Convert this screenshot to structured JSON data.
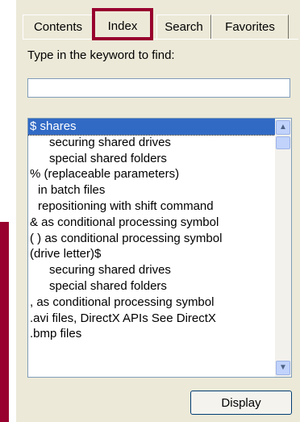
{
  "colors": {
    "accent": "#98002e",
    "selection": "#316ac5",
    "panel": "#ece9d8"
  },
  "tabs": [
    {
      "label": "Contents"
    },
    {
      "label": "Index"
    },
    {
      "label": "Search"
    },
    {
      "label": "Favorites"
    }
  ],
  "prompt": "Type in the keyword to find:",
  "search": {
    "value": ""
  },
  "list": {
    "items": [
      "$ shares",
      "securing shared drives",
      "special shared folders",
      "% (replaceable parameters)",
      "in batch files",
      "repositioning with shift command",
      "& as conditional processing symbol",
      "( ) as conditional processing symbol",
      "(drive letter)$",
      "securing shared drives",
      "special shared folders",
      ", as conditional processing symbol",
      ".avi files, DirectX APIs See DirectX",
      ".bmp files"
    ],
    "icons": {
      "scroll_up": "chevron-up-icon",
      "scroll_down": "chevron-down-icon"
    }
  },
  "display_button": "Display"
}
